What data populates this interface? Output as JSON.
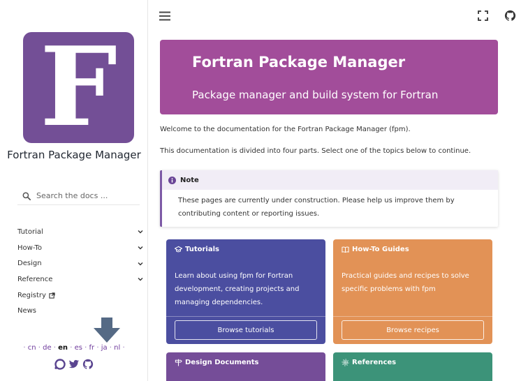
{
  "sidebar": {
    "logo_letter": "F",
    "project_name": "Fortran Package Manager",
    "search_placeholder": "Search the docs ...",
    "nav": [
      {
        "label": "Tutorial",
        "expandable": true
      },
      {
        "label": "How-To",
        "expandable": true
      },
      {
        "label": "Design",
        "expandable": true
      },
      {
        "label": "Reference",
        "expandable": true
      },
      {
        "label": "Registry",
        "external": true
      },
      {
        "label": "News"
      }
    ],
    "languages": [
      {
        "code": "cn"
      },
      {
        "code": "de"
      },
      {
        "code": "en",
        "current": true
      },
      {
        "code": "es"
      },
      {
        "code": "fr"
      },
      {
        "code": "ja"
      },
      {
        "code": "nl"
      }
    ],
    "social_icons": [
      "discourse-icon",
      "twitter-icon",
      "github-icon"
    ]
  },
  "topbar": {
    "icons": [
      "hamburger-menu-icon",
      "fullscreen-icon",
      "github-icon"
    ]
  },
  "hero": {
    "title": "Fortran Package Manager",
    "subtitle": "Package manager and build system for Fortran"
  },
  "intro": {
    "p1": "Welcome to the documentation for the Fortran Package Manager (fpm).",
    "p2": "This documentation is divided into four parts. Select one of the topics below to continue."
  },
  "note": {
    "title": "Note",
    "body": "These pages are currently under construction. Please help us improve them by contributing content or reporting issues."
  },
  "cards": [
    {
      "title": "Tutorials",
      "desc": "Learn about using fpm for Fortran development, creating projects and managing dependencies.",
      "button": "Browse tutorials",
      "color": "#4b4ea0"
    },
    {
      "title": "How-To Guides",
      "desc": "Practical guides and recipes to solve specific problems with fpm",
      "button": "Browse recipes",
      "color": "#e29256"
    },
    {
      "title": "Design Documents",
      "color": "#754d98"
    },
    {
      "title": "References",
      "color": "#3c9379"
    }
  ],
  "colors": {
    "accent": "#734f96",
    "hero": "#a24d9a",
    "note_border": "#7d5aa6"
  }
}
